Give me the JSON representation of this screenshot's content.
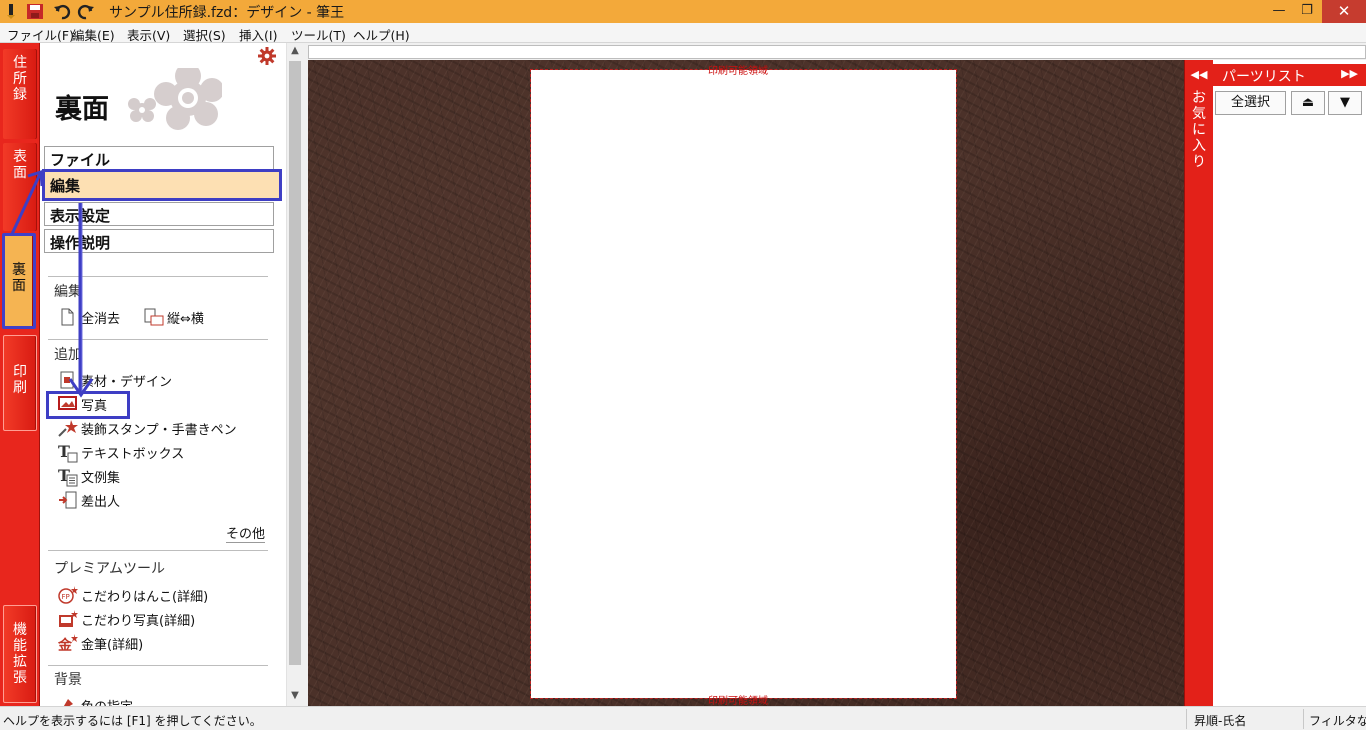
{
  "window": {
    "title": "サンプル住所録.fzd：デザイン - 筆王",
    "controls": {
      "minimize": "—",
      "restore": "❐",
      "close": "✕"
    }
  },
  "menu": [
    "ファイル(F)",
    "編集(E)",
    "表示(V)",
    "選択(S)",
    "挿入(I)",
    "ツール(T)",
    "ヘルプ(H)"
  ],
  "left_tabs": [
    {
      "label": "住所録",
      "state": "normal"
    },
    {
      "label": "表面",
      "state": "normal"
    },
    {
      "label": "裏面",
      "state": "active"
    },
    {
      "label": "印刷",
      "state": "outlined"
    },
    {
      "label": "機能拡張",
      "state": "outlined"
    }
  ],
  "panel": {
    "title": "裏面",
    "nav": [
      {
        "label": "ファイル",
        "selected": false
      },
      {
        "label": "編集",
        "selected": true
      },
      {
        "label": "表示設定",
        "selected": false
      },
      {
        "label": "操作説明",
        "selected": false
      }
    ],
    "sections": {
      "edit": "編集",
      "add": "追加",
      "premium": "プレミアムツール",
      "background": "背景"
    },
    "edit_items": [
      {
        "label": "全消去",
        "icon": "document-icon"
      },
      {
        "label": "縦⇔横",
        "icon": "rotate-page-icon"
      }
    ],
    "add_items": [
      {
        "label": "素材・デザイン",
        "icon": "material-icon"
      },
      {
        "label": "写真",
        "icon": "photo-icon"
      },
      {
        "label": "装飾スタンプ・手書きペン",
        "icon": "stamp-pen-icon"
      },
      {
        "label": "テキストボックス",
        "icon": "textbox-icon"
      },
      {
        "label": "文例集",
        "icon": "phrases-icon"
      },
      {
        "label": "差出人",
        "icon": "sender-icon"
      }
    ],
    "more": "その他",
    "premium_items": [
      {
        "label": "こだわりはんこ(詳細)",
        "icon": "stamp-seal-icon"
      },
      {
        "label": "こだわり写真(詳細)",
        "icon": "premium-photo-icon"
      },
      {
        "label": "金筆(詳細)",
        "icon": "gold-brush-icon"
      }
    ],
    "background_items": [
      {
        "label": "色の指定",
        "icon": "color-icon"
      }
    ]
  },
  "canvas": {
    "print_area_top": "印刷可能領域",
    "print_area_bottom": "印刷可能領域"
  },
  "right_panel": {
    "favorites": "お気に入り",
    "parts_list": "パーツリスト",
    "select_all": "全選択",
    "collapse": "◀◀",
    "expand": "▶▶",
    "up": "⏏",
    "down": "▼"
  },
  "status": {
    "help": "ヘルプを表示するには [F1] を押してください。",
    "sort": "昇順-氏名",
    "filter": "フィルタなし"
  },
  "colors": {
    "accent_red": "#e32119",
    "title_orange": "#f3a93a",
    "highlight_blue": "#3e3ec4",
    "selected_fill": "#fde0b3",
    "canvas_brown": "#4b3129"
  }
}
